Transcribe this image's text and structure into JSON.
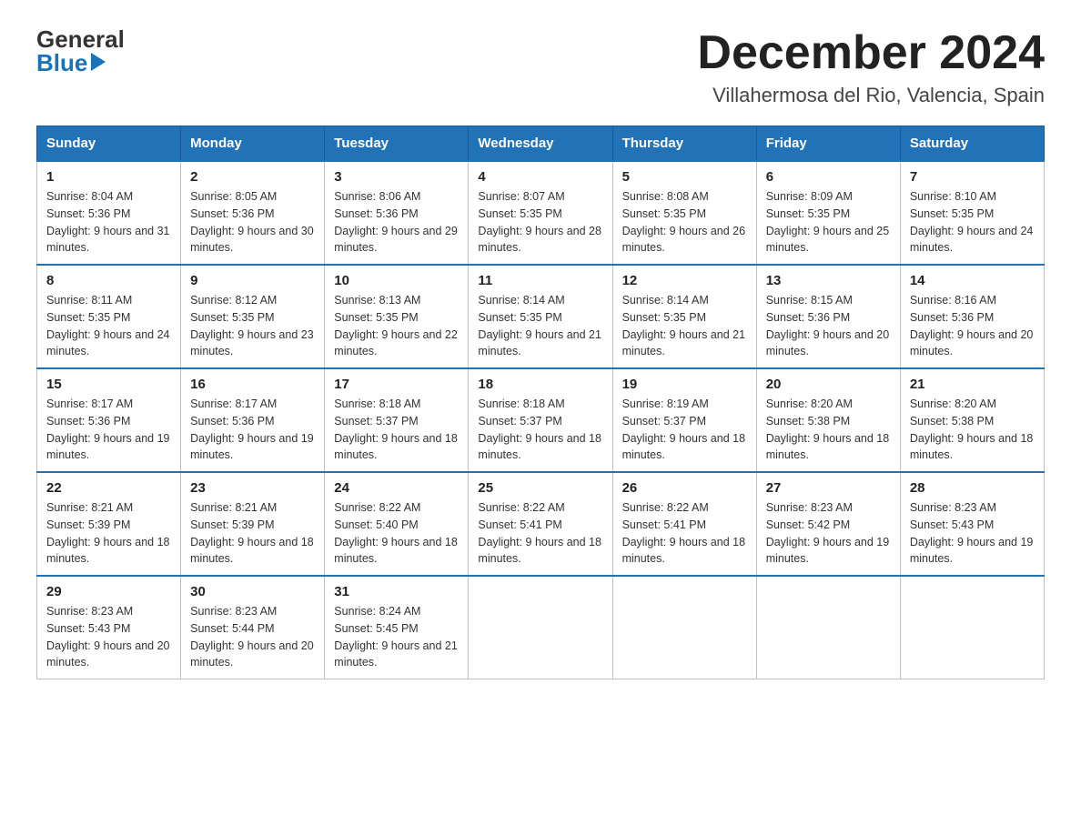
{
  "logo": {
    "general": "General",
    "blue": "Blue"
  },
  "header": {
    "title": "December 2024",
    "location": "Villahermosa del Rio, Valencia, Spain"
  },
  "days_header": [
    "Sunday",
    "Monday",
    "Tuesday",
    "Wednesday",
    "Thursday",
    "Friday",
    "Saturday"
  ],
  "weeks": [
    [
      {
        "day": "1",
        "sunrise": "8:04 AM",
        "sunset": "5:36 PM",
        "daylight": "9 hours and 31 minutes."
      },
      {
        "day": "2",
        "sunrise": "8:05 AM",
        "sunset": "5:36 PM",
        "daylight": "9 hours and 30 minutes."
      },
      {
        "day": "3",
        "sunrise": "8:06 AM",
        "sunset": "5:36 PM",
        "daylight": "9 hours and 29 minutes."
      },
      {
        "day": "4",
        "sunrise": "8:07 AM",
        "sunset": "5:35 PM",
        "daylight": "9 hours and 28 minutes."
      },
      {
        "day": "5",
        "sunrise": "8:08 AM",
        "sunset": "5:35 PM",
        "daylight": "9 hours and 26 minutes."
      },
      {
        "day": "6",
        "sunrise": "8:09 AM",
        "sunset": "5:35 PM",
        "daylight": "9 hours and 25 minutes."
      },
      {
        "day": "7",
        "sunrise": "8:10 AM",
        "sunset": "5:35 PM",
        "daylight": "9 hours and 24 minutes."
      }
    ],
    [
      {
        "day": "8",
        "sunrise": "8:11 AM",
        "sunset": "5:35 PM",
        "daylight": "9 hours and 24 minutes."
      },
      {
        "day": "9",
        "sunrise": "8:12 AM",
        "sunset": "5:35 PM",
        "daylight": "9 hours and 23 minutes."
      },
      {
        "day": "10",
        "sunrise": "8:13 AM",
        "sunset": "5:35 PM",
        "daylight": "9 hours and 22 minutes."
      },
      {
        "day": "11",
        "sunrise": "8:14 AM",
        "sunset": "5:35 PM",
        "daylight": "9 hours and 21 minutes."
      },
      {
        "day": "12",
        "sunrise": "8:14 AM",
        "sunset": "5:35 PM",
        "daylight": "9 hours and 21 minutes."
      },
      {
        "day": "13",
        "sunrise": "8:15 AM",
        "sunset": "5:36 PM",
        "daylight": "9 hours and 20 minutes."
      },
      {
        "day": "14",
        "sunrise": "8:16 AM",
        "sunset": "5:36 PM",
        "daylight": "9 hours and 20 minutes."
      }
    ],
    [
      {
        "day": "15",
        "sunrise": "8:17 AM",
        "sunset": "5:36 PM",
        "daylight": "9 hours and 19 minutes."
      },
      {
        "day": "16",
        "sunrise": "8:17 AM",
        "sunset": "5:36 PM",
        "daylight": "9 hours and 19 minutes."
      },
      {
        "day": "17",
        "sunrise": "8:18 AM",
        "sunset": "5:37 PM",
        "daylight": "9 hours and 18 minutes."
      },
      {
        "day": "18",
        "sunrise": "8:18 AM",
        "sunset": "5:37 PM",
        "daylight": "9 hours and 18 minutes."
      },
      {
        "day": "19",
        "sunrise": "8:19 AM",
        "sunset": "5:37 PM",
        "daylight": "9 hours and 18 minutes."
      },
      {
        "day": "20",
        "sunrise": "8:20 AM",
        "sunset": "5:38 PM",
        "daylight": "9 hours and 18 minutes."
      },
      {
        "day": "21",
        "sunrise": "8:20 AM",
        "sunset": "5:38 PM",
        "daylight": "9 hours and 18 minutes."
      }
    ],
    [
      {
        "day": "22",
        "sunrise": "8:21 AM",
        "sunset": "5:39 PM",
        "daylight": "9 hours and 18 minutes."
      },
      {
        "day": "23",
        "sunrise": "8:21 AM",
        "sunset": "5:39 PM",
        "daylight": "9 hours and 18 minutes."
      },
      {
        "day": "24",
        "sunrise": "8:22 AM",
        "sunset": "5:40 PM",
        "daylight": "9 hours and 18 minutes."
      },
      {
        "day": "25",
        "sunrise": "8:22 AM",
        "sunset": "5:41 PM",
        "daylight": "9 hours and 18 minutes."
      },
      {
        "day": "26",
        "sunrise": "8:22 AM",
        "sunset": "5:41 PM",
        "daylight": "9 hours and 18 minutes."
      },
      {
        "day": "27",
        "sunrise": "8:23 AM",
        "sunset": "5:42 PM",
        "daylight": "9 hours and 19 minutes."
      },
      {
        "day": "28",
        "sunrise": "8:23 AM",
        "sunset": "5:43 PM",
        "daylight": "9 hours and 19 minutes."
      }
    ],
    [
      {
        "day": "29",
        "sunrise": "8:23 AM",
        "sunset": "5:43 PM",
        "daylight": "9 hours and 20 minutes."
      },
      {
        "day": "30",
        "sunrise": "8:23 AM",
        "sunset": "5:44 PM",
        "daylight": "9 hours and 20 minutes."
      },
      {
        "day": "31",
        "sunrise": "8:24 AM",
        "sunset": "5:45 PM",
        "daylight": "9 hours and 21 minutes."
      },
      null,
      null,
      null,
      null
    ]
  ]
}
